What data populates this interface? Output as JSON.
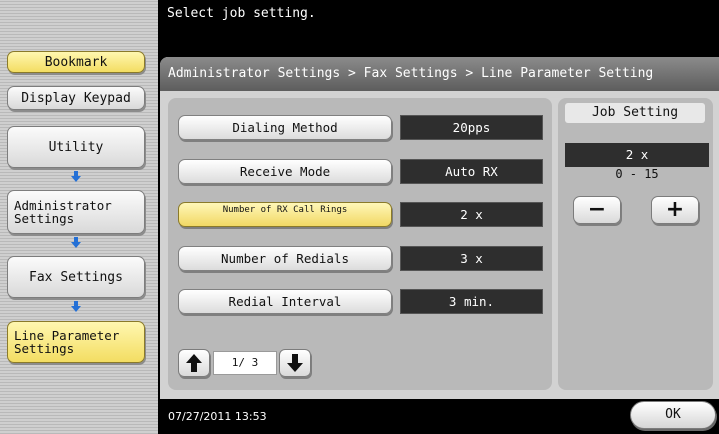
{
  "header": {
    "message": "Select job setting."
  },
  "sidebar": {
    "bookmark": "Bookmark",
    "display_keypad": "Display Keypad",
    "utility": "Utility",
    "administrator_settings": "Administrator Settings",
    "fax_settings": "Fax Settings",
    "line_parameter_settings": "Line Parameter Settings"
  },
  "breadcrumb": "Administrator Settings  > Fax Settings  > Line Parameter Setting",
  "settings": [
    {
      "label": "Dialing Method",
      "value": "20pps"
    },
    {
      "label": "Receive Mode",
      "value": "Auto RX"
    },
    {
      "label": "Number of RX Call Rings",
      "value": "2  x"
    },
    {
      "label": "Number of Redials",
      "value": "3  x"
    },
    {
      "label": "Redial Interval",
      "value": "3  min."
    }
  ],
  "pager": {
    "text": "1/  3"
  },
  "job_setting": {
    "title": "Job Setting",
    "value": "2  x",
    "range": "0  -  15",
    "minus": "−",
    "plus": "+"
  },
  "footer": {
    "datetime": "07/27/2011   13:53",
    "ok": "OK"
  },
  "colors": {
    "selected_yellow": "#f3dd62",
    "arrow_blue": "#2470d6"
  }
}
